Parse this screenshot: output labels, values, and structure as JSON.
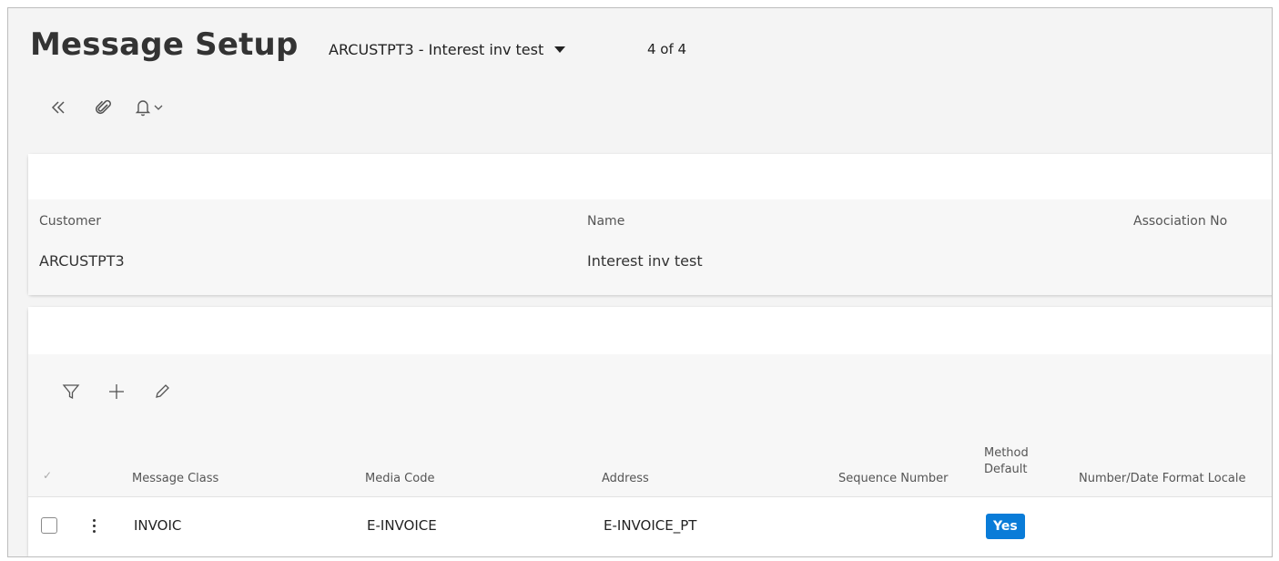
{
  "page": {
    "title": "Message Setup",
    "record_selector": "ARCUSTPT3 - Interest inv test",
    "record_count": "4 of 4"
  },
  "icons": {
    "back": "double-chevron-left-icon",
    "attach": "paperclip-icon",
    "notify": "bell-icon",
    "filter": "filter-icon",
    "add": "plus-icon",
    "edit": "pencil-icon"
  },
  "customer_card": {
    "fields": [
      {
        "label": "Customer",
        "value": "ARCUSTPT3"
      },
      {
        "label": "Name",
        "value": "Interest inv test"
      },
      {
        "label": "Association No",
        "value": ""
      }
    ]
  },
  "message_table": {
    "columns": [
      "Message Class",
      "Media Code",
      "Address",
      "Sequence Number",
      "Method Default",
      "Number/Date Format Locale"
    ],
    "rows": [
      {
        "message_class": "INVOIC",
        "media_code": "E-INVOICE",
        "address": "E-INVOICE_PT",
        "sequence_number": "",
        "method_default": "Yes",
        "locale": ""
      }
    ]
  },
  "colors": {
    "accent": "#0a7cd8",
    "background": "#f4f4f4"
  }
}
